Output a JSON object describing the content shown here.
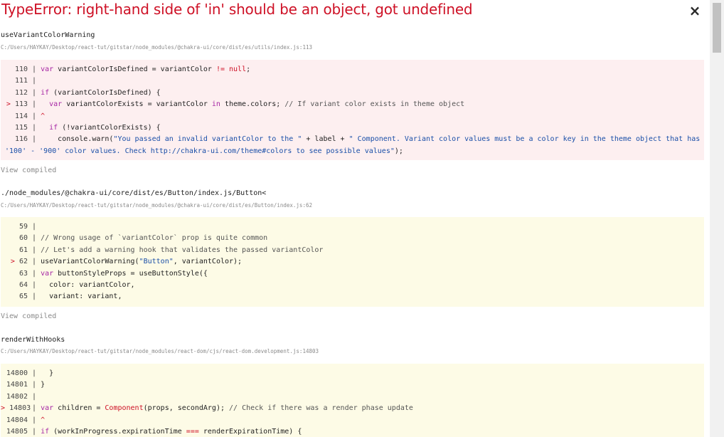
{
  "error": {
    "title": "TypeError: right-hand side of 'in' should be an object, got undefined",
    "close_symbol": "×"
  },
  "frames": [
    {
      "name": "useVariantColorWarning",
      "location": "C:/Users/HAYKAY/Desktop/react-tut/gitstar/node_modules/@chakra-ui/core/dist/es/utils/index.js:113",
      "view_compiled": "View compiled"
    },
    {
      "name": "./node_modules/@chakra-ui/core/dist/es/Button/index.js/Button<",
      "location": "C:/Users/HAYKAY/Desktop/react-tut/gitstar/node_modules/@chakra-ui/core/dist/es/Button/index.js:62",
      "view_compiled": "View compiled"
    },
    {
      "name": "renderWithHooks",
      "location": "C:/Users/HAYKAY/Desktop/react-tut/gitstar/node_modules/react-dom/cjs/react-dom.development.js:14803"
    }
  ],
  "code": {
    "f0": {
      "n110": "110",
      "n111": "111",
      "n112": "112",
      "n113": "113",
      "n114": "114",
      "n115": "115",
      "n116": "116",
      "l110_kw": "var",
      "l110_a": " variantColorIsDefined = variantColor ",
      "l110_op": "!=",
      "l110_b": " ",
      "l110_null": "null",
      "l110_c": ";",
      "l112_kw": "if",
      "l112_a": " (variantColorIsDefined) {",
      "l113_kw": "var",
      "l113_a": " variantColorExists = variantColor ",
      "l113_in": "in",
      "l113_b": " theme.colors; ",
      "l113_cm": "// If variant color exists in theme object",
      "l114_caret": "^",
      "l115_kw": "if",
      "l115_a": " (!variantColorExists) {",
      "l116_a": "console.warn(",
      "l116_s1": "\"You passed an invalid variantColor to the \"",
      "l116_p1": " + label + ",
      "l116_s2": "\" Component. Variant color values must be a color key in the theme object that has '100' - '900' color values. Check http://chakra-ui.com/theme#colors to see possible values\"",
      "l116_end": ");"
    },
    "f1": {
      "n59": "59",
      "n60": "60",
      "n61": "61",
      "n62": "62",
      "n63": "63",
      "n64": "64",
      "n65": "65",
      "l60_cm": "// Wrong usage of `variantColor` prop is quite common",
      "l61_cm": "// Let's add a warning hook that validates the passed variantColor",
      "l62_a": "useVariantColorWarning(",
      "l62_s": "\"Button\"",
      "l62_b": ", variantColor);",
      "l63_kw": "var",
      "l63_a": " buttonStyleProps = useButtonStyle({",
      "l64_a": "color: variantColor,",
      "l65_a": "variant: variant,"
    },
    "f2": {
      "n14800": "14800",
      "n14801": "14801",
      "n14802": "14802",
      "n14803": "14803",
      "n14804": "14804",
      "n14805": "14805",
      "l14800_a": "}",
      "l14801_a": "}",
      "l14803_kw": "var",
      "l14803_a": " children = ",
      "l14803_fn": "Component",
      "l14803_b": "(props, secondArg); ",
      "l14803_cm": "// Check if there was a render phase update",
      "l14804_caret": "^",
      "l14805_kw": "if",
      "l14805_a": " (workInProgress.expirationTime ",
      "l14805_op": "===",
      "l14805_b": " renderExpirationTime) {"
    },
    "marker": ">",
    "bar": "|"
  },
  "colors": {
    "error_red": "#ce1126",
    "error_bg": "#fdeff0",
    "warn_bg": "#fdfbe6"
  }
}
